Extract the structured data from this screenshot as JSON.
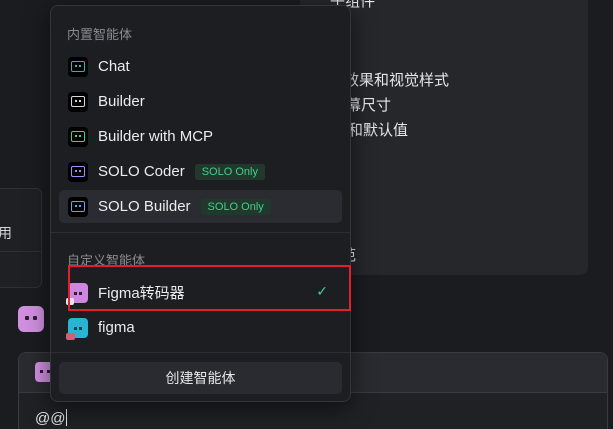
{
  "background": {
    "lines": [
      "子组件",
      "效果和视觉样式",
      "幕尺寸",
      "和默认值",
      "",
      "范"
    ],
    "left_text": "用",
    "input_text": "@@"
  },
  "dropdown": {
    "builtin_title": "内置智能体",
    "builtin_items": [
      {
        "label": "Chat",
        "icon": "chat-agent-icon",
        "color": "#2fb6b0"
      },
      {
        "label": "Builder",
        "icon": "builder-agent-icon",
        "color": "#d8d8dc"
      },
      {
        "label": "Builder with MCP",
        "icon": "builder-mcp-agent-icon",
        "color": "#3fd18a"
      },
      {
        "label": "SOLO Coder",
        "icon": "solo-coder-agent-icon",
        "color": "#a78bfa",
        "badge": "SOLO Only"
      },
      {
        "label": "SOLO Builder",
        "icon": "solo-builder-agent-icon",
        "color": "#60a5fa",
        "badge": "SOLO Only"
      }
    ],
    "custom_title": "自定义智能体",
    "custom_items": [
      {
        "label": "Figma转码器",
        "icon": "figma-transcoder-agent-icon",
        "selected": true
      },
      {
        "label": "figma",
        "icon": "figma-agent-icon"
      }
    ],
    "create_label": "创建智能体",
    "check_glyph": "✓"
  },
  "colors": {
    "accent_green": "#3fd18a",
    "highlight_red": "#e0202c"
  }
}
